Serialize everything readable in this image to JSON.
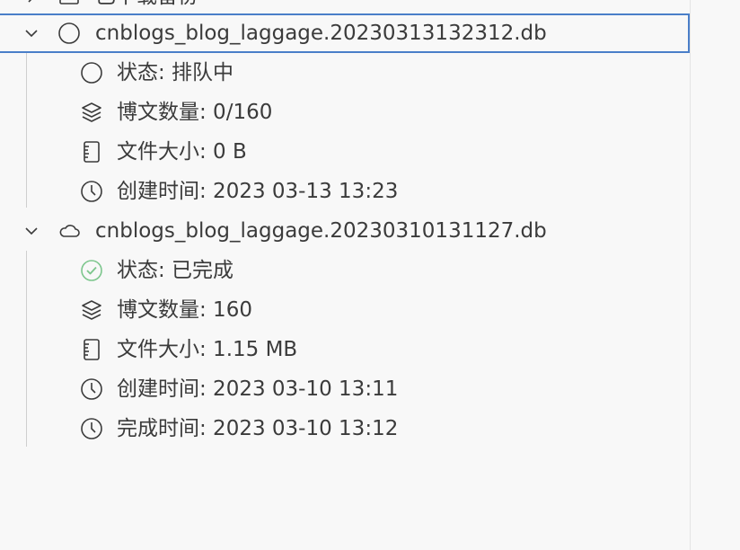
{
  "partial_top_item": {
    "label": "已下载备份"
  },
  "items": [
    {
      "filename": "cnblogs_blog_laggage.20230313132312.db",
      "status_icon": "circle-outline-icon",
      "expanded": true,
      "selected": true,
      "details": {
        "status": "状态: 排队中",
        "post_count": "博文数量: 0/160",
        "file_size": "文件大小: 0 B",
        "created_time": "创建时间: 2023 03-13 13:23"
      }
    },
    {
      "filename": "cnblogs_blog_laggage.20230310131127.db",
      "status_icon": "cloud-icon",
      "expanded": true,
      "selected": false,
      "details": {
        "status": "状态: 已完成",
        "post_count": "博文数量: 160",
        "file_size": "文件大小: 1.15 MB",
        "created_time": "创建时间: 2023 03-10 13:11",
        "completed_time": "完成时间: 2023 03-10 13:12"
      }
    }
  ],
  "colors": {
    "selection_border": "#4a7fc9",
    "success_green": "#7cc68c",
    "text": "#3b3b3b",
    "background": "#f8f8f8"
  }
}
